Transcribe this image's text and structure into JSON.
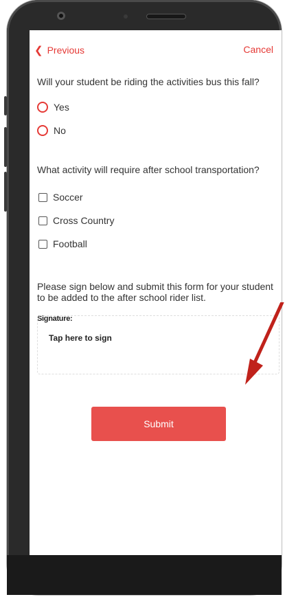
{
  "nav": {
    "previous_label": "Previous",
    "cancel_label": "Cancel"
  },
  "question1": {
    "text": "Will your student be riding the activities bus this fall?",
    "options": [
      "Yes",
      "No"
    ]
  },
  "question2": {
    "text": "What activity will require after school transportation?",
    "options": [
      "Soccer",
      "Cross Country",
      "Football"
    ]
  },
  "instructions": "Please sign below and submit this form for your student to be added to the after school rider list.",
  "signature": {
    "label": "Signature:",
    "placeholder": "Tap here to sign"
  },
  "submit_label": "Submit",
  "colors": {
    "accent": "#e53935",
    "button": "#e8504d",
    "arrow": "#c0221b"
  }
}
